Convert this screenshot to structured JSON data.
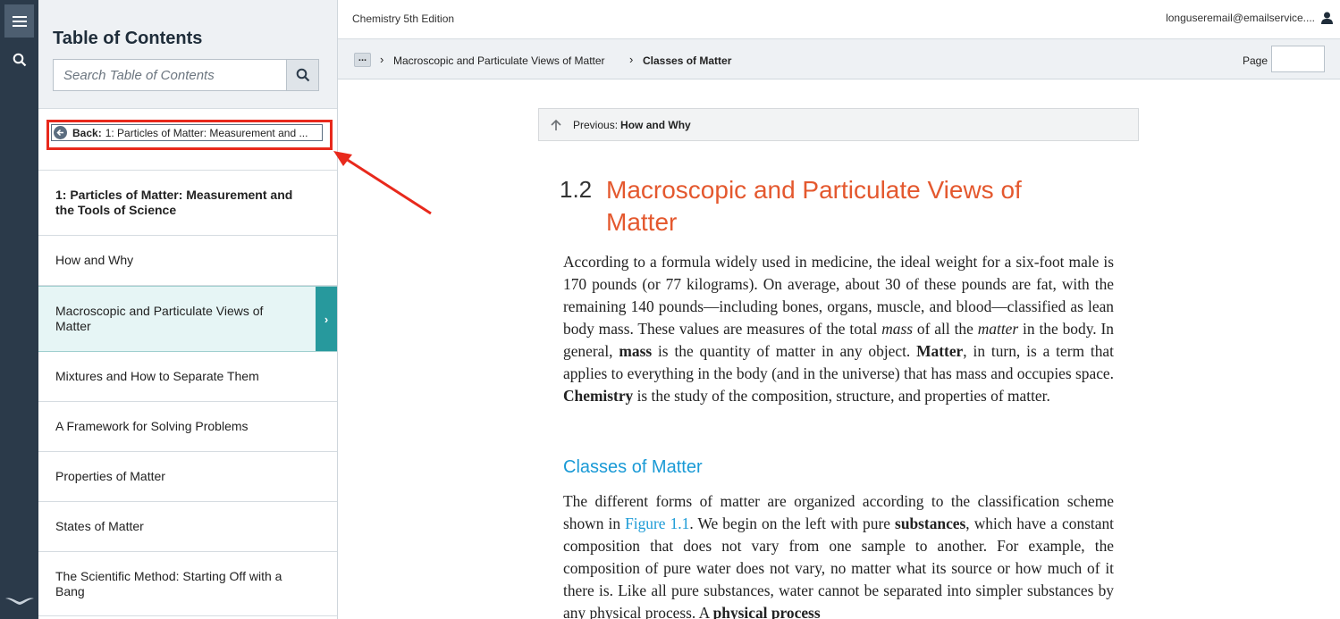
{
  "book_title": "Chemistry 5th Edition",
  "user_email": "longuseremail@emailservice....",
  "sidebar": {
    "title": "Table of Contents",
    "search_placeholder": "Search Table of Contents",
    "back_label": "Back:",
    "back_text": "1: Particles of Matter: Measurement and ...",
    "items": [
      {
        "label": "1: Particles of Matter: Measurement and the Tools of Science",
        "type": "chapter"
      },
      {
        "label": "How and Why",
        "type": "normal"
      },
      {
        "label": "Macroscopic and Particulate Views of Matter",
        "type": "active"
      },
      {
        "label": "Mixtures and How to Separate Them",
        "type": "normal"
      },
      {
        "label": "A Framework for Solving Problems",
        "type": "normal"
      },
      {
        "label": "Properties of Matter",
        "type": "normal"
      },
      {
        "label": "States of Matter",
        "type": "normal"
      },
      {
        "label": "The Scientific Method: Starting Off with a Bang",
        "type": "normal"
      }
    ]
  },
  "breadcrumb": {
    "ellipsis": "...",
    "section": "Macroscopic and Particulate Views of Matter",
    "current": "Classes of Matter",
    "sep": "›"
  },
  "page": {
    "label": "Page",
    "value": ""
  },
  "content": {
    "previous_label": "Previous:",
    "previous_title": "How and Why",
    "section_number": "1.2",
    "section_title": "Macroscopic and Particulate Views of Matter",
    "subheading": "Classes of Matter",
    "p1": {
      "t1": "According to a formula widely used in medicine, the ideal weight for a six-foot male is 170 pounds (or 77 kilograms). On average, about 30 of these pounds are fat, with the remaining 140 pounds—including bones, organs, muscle, and blood—classified as lean body mass. These values are measures of the total ",
      "e1": "mass",
      "t2": " of all the ",
      "e2": "matter",
      "t3": " in the body. In general, ",
      "b1": "mass",
      "t4": " is the quantity of matter in any object. ",
      "b2": "Matter",
      "t5": ", in turn, is a term that applies to everything in the body (and in the universe) that has mass and occupies space. ",
      "b3": "Chemistry",
      "t6": " is the study of the composition, structure, and properties of matter."
    },
    "p2": {
      "t1": "The different forms of matter are organized according to the classification scheme shown in ",
      "link": "Figure 1.1",
      "t2": ". We begin on the left with pure ",
      "b1": "substances",
      "t3": ", which have a constant composition that does not vary from one sample to another. For example, the composition of pure water does not vary, no matter what its source or how much of it there is. Like all pure substances, water cannot be separated into simpler substances by any physical process. A ",
      "b2": "physical process"
    }
  },
  "colors": {
    "rail": "#2b3a4a",
    "section_title": "#e4582e",
    "subheading": "#1a9ad6",
    "active_tab": "#27999d",
    "highlight": "#e8291c"
  }
}
